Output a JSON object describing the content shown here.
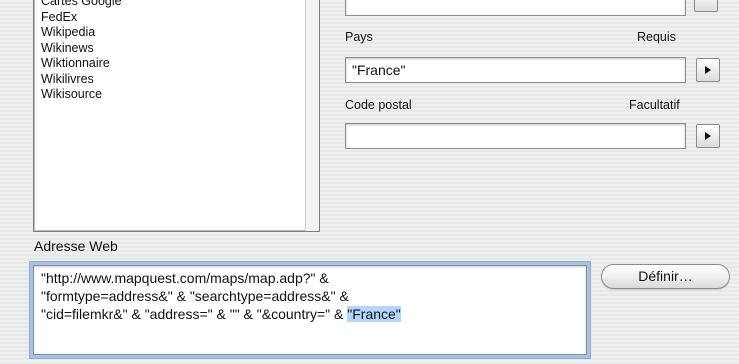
{
  "services": {
    "items": [
      "Cartes Google",
      "FedEx",
      "Wikipedia",
      "Wikinews",
      "Wiktionnaire",
      "Wikilivres",
      "Wikisource"
    ]
  },
  "fields": {
    "country": {
      "label": "Pays",
      "requirement": "Requis",
      "value": "\"France\""
    },
    "postal_code": {
      "label": "Code postal",
      "requirement": "Facultatif",
      "value": ""
    }
  },
  "web_address": {
    "label": "Adresse Web",
    "line1": "\"http://www.mapquest.com/maps/map.adp?\" &",
    "line2": "\"formtype=address&\" & \"searchtype=address&\" &",
    "line3_prefix": "\"cid=filemkr&\" & \"address=\" & \"\" & \"&country=\" & ",
    "line3_selected": "\"France\"",
    "define_button": "Définir…"
  },
  "icons": {
    "field_arrow": "triangle-right-icon"
  },
  "colors": {
    "selection": "#b5d5ff",
    "focus_ring": "#a6c3e6"
  }
}
